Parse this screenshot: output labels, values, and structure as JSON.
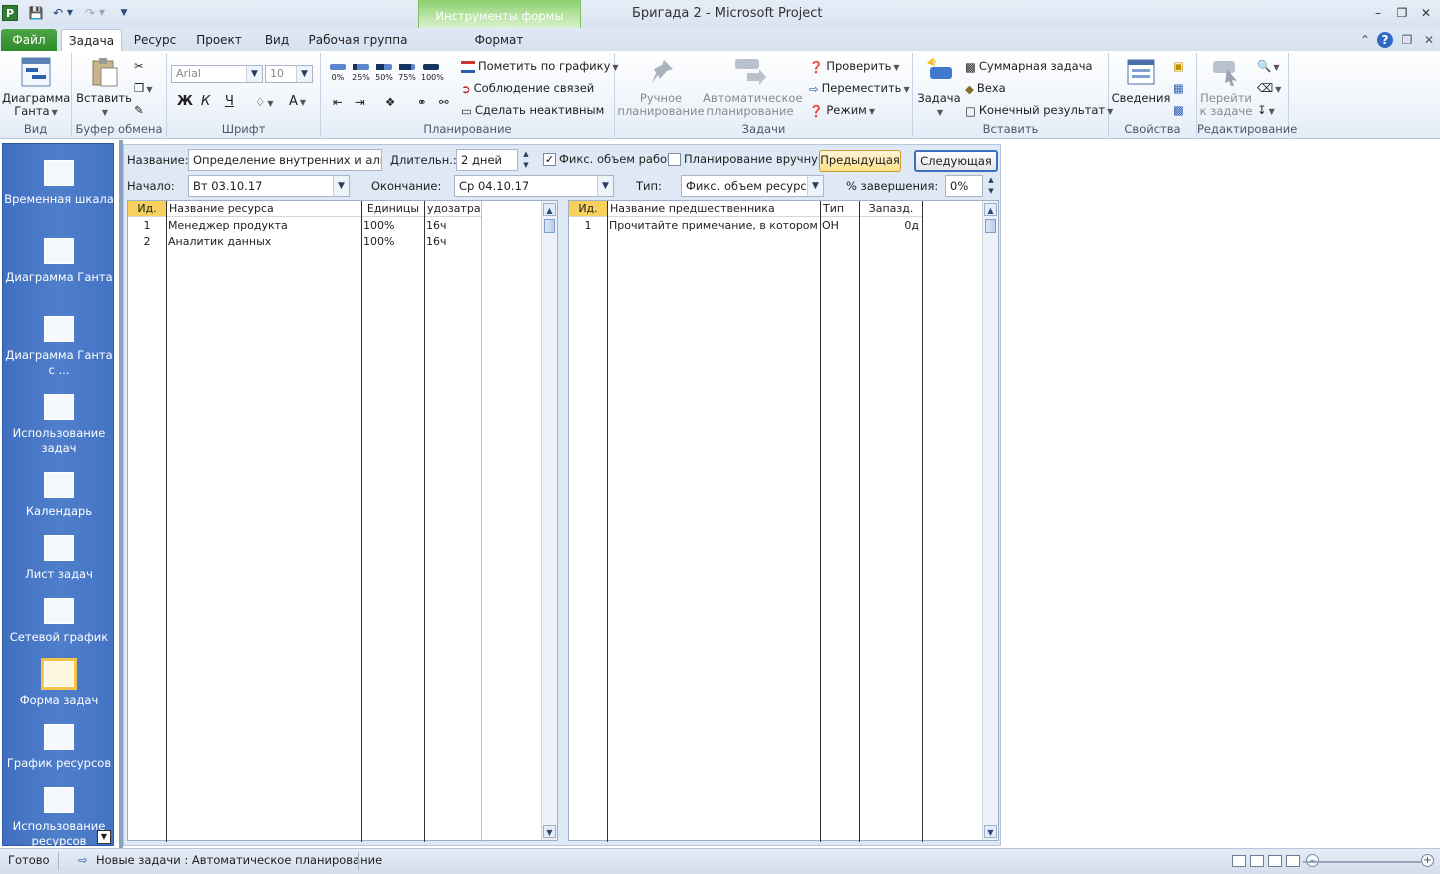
{
  "window": {
    "title": "Бригада 2  -  Microsoft Project",
    "context_group": "Инструменты формы задач"
  },
  "tabs": [
    {
      "label": "Файл"
    },
    {
      "label": "Задача"
    },
    {
      "label": "Ресурс"
    },
    {
      "label": "Проект"
    },
    {
      "label": "Вид"
    },
    {
      "label": "Рабочая группа"
    },
    {
      "label": "Формат"
    }
  ],
  "ribbon": {
    "view": {
      "label": "Вид",
      "gantt": "Диаграмма Ганта"
    },
    "clipboard": {
      "label": "Буфер обмена",
      "paste": "Вставить"
    },
    "font": {
      "label": "Шрифт",
      "family": "Arial",
      "size": "10",
      "bold": "Ж",
      "italic": "К",
      "underline": "Ч",
      "color": "A"
    },
    "schedule": {
      "label": "Планирование",
      "pcts": [
        "0%",
        "25%",
        "50%",
        "75%",
        "100%"
      ],
      "mark": "Пометить по графику",
      "respect": "Соблюдение связей",
      "inactivate": "Сделать неактивным"
    },
    "tasks": {
      "label": "Задачи",
      "manual": "Ручное планирование",
      "auto": "Автоматическое планирование",
      "inspect": "Проверить",
      "move": "Переместить",
      "mode": "Режим"
    },
    "insert": {
      "label": "Вставить",
      "task": "Задача",
      "summary": "Суммарная задача",
      "milestone": "Веха",
      "deliverable": "Конечный результат"
    },
    "properties": {
      "label": "Свойства",
      "info": "Сведения"
    },
    "editing": {
      "label": "Редактирование",
      "goto": "Перейти к задаче"
    }
  },
  "views": [
    {
      "label": "Временная шкала"
    },
    {
      "label": "Диаграмма Ганта"
    },
    {
      "label": "Диаграмма Ганта с ..."
    },
    {
      "label": "Использование задач"
    },
    {
      "label": "Календарь"
    },
    {
      "label": "Лист задач"
    },
    {
      "label": "Сетевой график"
    },
    {
      "label": "Форма задач",
      "selected": true
    },
    {
      "label": "График ресурсов"
    },
    {
      "label": "Использование ресурсов"
    }
  ],
  "form": {
    "name_label": "Название:",
    "name_value": "Определение внутренних и альтерн",
    "duration_label": "Длительн.:",
    "duration_value": "2 дней",
    "effort_label": "Фикс. объем работ",
    "effort_checked": true,
    "manual_label": "Планирование вручную",
    "manual_checked": false,
    "prev": "Предыдущая",
    "next": "Следующая",
    "start_label": "Начало:",
    "start_value": "Вт 03.10.17",
    "finish_label": "Окончание:",
    "finish_value": "Ср 04.10.17",
    "type_label": "Тип:",
    "type_value": "Фикс. объем ресурсов",
    "pct_label": "% завершения:",
    "pct_value": "0%"
  },
  "resources": {
    "headers": [
      "Ид.",
      "Название ресурса",
      "Единицы",
      "удозатрат"
    ],
    "rows": [
      [
        "1",
        "Менеджер продукта",
        "100%",
        "16ч"
      ],
      [
        "2",
        "Аналитик данных",
        "100%",
        "16ч"
      ]
    ]
  },
  "predecessors": {
    "headers": [
      "Ид.",
      "Название предшественника",
      "Тип",
      "Запазд."
    ],
    "rows": [
      [
        "1",
        "Прочитайте примечание, в котором объ",
        "ОН",
        "0д"
      ]
    ]
  },
  "status": {
    "ready": "Готово",
    "new_tasks": "Новые задачи : Автоматическое планирование"
  }
}
